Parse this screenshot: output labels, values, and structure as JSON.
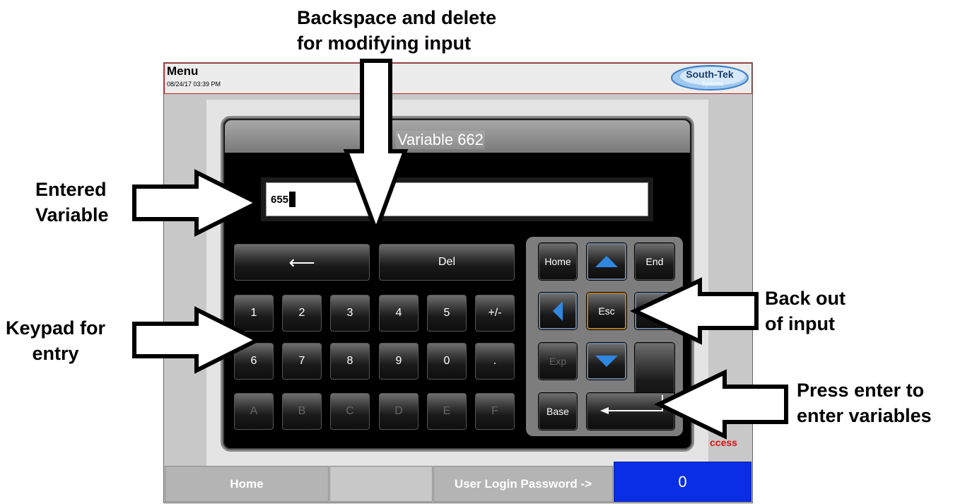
{
  "header": {
    "title": "Menu",
    "datetime": "08/24/17  03:39 PM"
  },
  "logo": {
    "name": "South-Tek",
    "sub": "Systems",
    "icon": "south-tek-logo"
  },
  "dialog": {
    "title": "Variable 662",
    "entry_value": "655"
  },
  "keypad": {
    "backspace_label": "⟵",
    "delete_label": "Del",
    "row1": [
      "1",
      "2",
      "3",
      "4",
      "5",
      "+/-"
    ],
    "row2": [
      "6",
      "7",
      "8",
      "9",
      "0",
      "."
    ],
    "row3": [
      "A",
      "B",
      "C",
      "D",
      "E",
      "F"
    ]
  },
  "nav": {
    "home": "Home",
    "up_icon": "up-arrow-icon",
    "end": "End",
    "left_icon": "left-arrow-icon",
    "esc": "Esc",
    "right_icon": "right-arrow-icon",
    "exp": "Exp",
    "down_icon": "down-arrow-icon",
    "base": "Base",
    "enter_icon": "enter-icon"
  },
  "status_text": "ccess",
  "bottom_bar": {
    "home": "Home",
    "password_label": "User Login Password ->",
    "password_value": "0"
  },
  "callouts": {
    "backspace": "Backspace and delete\nfor modifying input",
    "entered": "Entered\nVariable",
    "keypad": "Keypad for\nentry",
    "back_out": "Back out\nof input",
    "enter": "Press enter to\nenter variables"
  },
  "colors": {
    "accent_blue": "#2f87e0",
    "password_bg": "#0a2ee6",
    "status_red": "#e01010"
  }
}
